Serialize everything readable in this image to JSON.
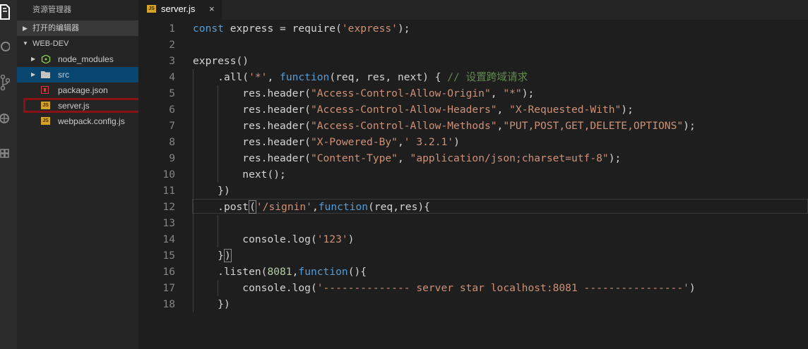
{
  "sidebar": {
    "title": "资源管理器",
    "open_editors": "打开的编辑器",
    "project": "WEB-DEV",
    "items": [
      {
        "label": "node_modules",
        "icon": "node-icon"
      },
      {
        "label": "src",
        "icon": "folder-icon"
      },
      {
        "label": "package.json",
        "icon": "json-icon"
      },
      {
        "label": "server.js",
        "icon": "js-icon"
      },
      {
        "label": "webpack.config.js",
        "icon": "js-icon"
      }
    ]
  },
  "tab": {
    "label": "server.js",
    "close": "×",
    "badge": "JS"
  },
  "code": {
    "lines": [
      {
        "n": "1",
        "indent": 0,
        "tokens": [
          {
            "c": "kw",
            "t": "const"
          },
          {
            "c": "",
            "t": " express = require("
          },
          {
            "c": "str",
            "t": "'express'"
          },
          {
            "c": "",
            "t": ");"
          }
        ]
      },
      {
        "n": "2",
        "indent": 0,
        "tokens": []
      },
      {
        "n": "3",
        "indent": 0,
        "tokens": [
          {
            "c": "",
            "t": "express()"
          }
        ]
      },
      {
        "n": "4",
        "indent": 4,
        "tokens": [
          {
            "c": "",
            "t": ".all("
          },
          {
            "c": "str",
            "t": "'*'"
          },
          {
            "c": "",
            "t": ", "
          },
          {
            "c": "kw",
            "t": "function"
          },
          {
            "c": "",
            "t": "(req, res, next) { "
          },
          {
            "c": "cmt",
            "t": "// 设置跨域请求"
          }
        ]
      },
      {
        "n": "5",
        "indent": 8,
        "tokens": [
          {
            "c": "",
            "t": "res.header("
          },
          {
            "c": "str",
            "t": "\"Access-Control-Allow-Origin\""
          },
          {
            "c": "",
            "t": ", "
          },
          {
            "c": "str",
            "t": "\"*\""
          },
          {
            "c": "",
            "t": ");"
          }
        ]
      },
      {
        "n": "6",
        "indent": 8,
        "tokens": [
          {
            "c": "",
            "t": "res.header("
          },
          {
            "c": "str",
            "t": "\"Access-Control-Allow-Headers\""
          },
          {
            "c": "",
            "t": ", "
          },
          {
            "c": "str",
            "t": "\"X-Requested-With\""
          },
          {
            "c": "",
            "t": ");"
          }
        ]
      },
      {
        "n": "7",
        "indent": 8,
        "tokens": [
          {
            "c": "",
            "t": "res.header("
          },
          {
            "c": "str",
            "t": "\"Access-Control-Allow-Methods\""
          },
          {
            "c": "",
            "t": ","
          },
          {
            "c": "str",
            "t": "\"PUT,POST,GET,DELETE,OPTIONS\""
          },
          {
            "c": "",
            "t": ");"
          }
        ]
      },
      {
        "n": "8",
        "indent": 8,
        "tokens": [
          {
            "c": "",
            "t": "res.header("
          },
          {
            "c": "str",
            "t": "\"X-Powered-By\""
          },
          {
            "c": "",
            "t": ","
          },
          {
            "c": "str",
            "t": "' 3.2.1'"
          },
          {
            "c": "",
            "t": ")"
          }
        ]
      },
      {
        "n": "9",
        "indent": 8,
        "tokens": [
          {
            "c": "",
            "t": "res.header("
          },
          {
            "c": "str",
            "t": "\"Content-Type\""
          },
          {
            "c": "",
            "t": ", "
          },
          {
            "c": "str",
            "t": "\"application/json;charset=utf-8\""
          },
          {
            "c": "",
            "t": ");"
          }
        ]
      },
      {
        "n": "10",
        "indent": 8,
        "tokens": [
          {
            "c": "",
            "t": "next();"
          }
        ]
      },
      {
        "n": "11",
        "indent": 4,
        "tokens": [
          {
            "c": "",
            "t": "})"
          }
        ]
      },
      {
        "n": "12",
        "indent": 4,
        "tokens": [
          {
            "c": "",
            "t": ".post"
          },
          {
            "c": "bracket",
            "t": "("
          },
          {
            "c": "str",
            "t": "'/signin'"
          },
          {
            "c": "",
            "t": ","
          },
          {
            "c": "kw",
            "t": "function"
          },
          {
            "c": "",
            "t": "(req,res){"
          }
        ]
      },
      {
        "n": "13",
        "indent": 0,
        "tokens": []
      },
      {
        "n": "14",
        "indent": 8,
        "tokens": [
          {
            "c": "",
            "t": "console.log("
          },
          {
            "c": "str",
            "t": "'123'"
          },
          {
            "c": "",
            "t": ")"
          }
        ]
      },
      {
        "n": "15",
        "indent": 4,
        "tokens": [
          {
            "c": "",
            "t": "}"
          },
          {
            "c": "bracket",
            "t": ")"
          }
        ]
      },
      {
        "n": "16",
        "indent": 4,
        "tokens": [
          {
            "c": "",
            "t": ".listen("
          },
          {
            "c": "num",
            "t": "8081"
          },
          {
            "c": "",
            "t": ","
          },
          {
            "c": "kw",
            "t": "function"
          },
          {
            "c": "",
            "t": "(){"
          }
        ]
      },
      {
        "n": "17",
        "indent": 8,
        "tokens": [
          {
            "c": "",
            "t": "console.log("
          },
          {
            "c": "str",
            "t": "'-------------- server star localhost:8081 ----------------'"
          },
          {
            "c": "",
            "t": ")"
          }
        ]
      },
      {
        "n": "18",
        "indent": 4,
        "tokens": [
          {
            "c": "",
            "t": "})"
          }
        ]
      }
    ],
    "current_line": "12"
  },
  "colors": {
    "keyword": "#569cd6",
    "string": "#ce9178",
    "number": "#b5cea8",
    "comment": "#608b4e",
    "selection": "#094771",
    "highlight_box": "#8b1212",
    "js_badge": "#d6a329"
  }
}
